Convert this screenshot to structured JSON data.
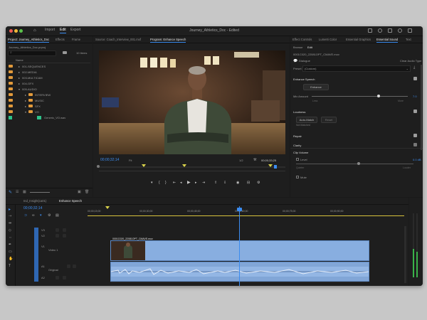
{
  "window": {
    "title": "Journey_Athletics_Doc - Edited"
  },
  "nav": {
    "import": "Import",
    "edit": "Edit",
    "export": "Export"
  },
  "project": {
    "tabs": [
      "Project: Journey_Athletics_Doc",
      "Effects",
      "Frame"
    ],
    "file": "Journey_Athletics_Doc.prproj",
    "item_count": "10 Items",
    "header": "Name",
    "folders": [
      "001-SEQUENCES",
      "002-MEDIA",
      "003-MULTICAM",
      "004-GFX",
      "005-AUDIO",
      "INTERVIEW",
      "MUSIC",
      "SFX",
      "VO"
    ],
    "file_item": "Generic_VO.wav"
  },
  "program": {
    "tabs": [
      "Source: Coach_Interview_001.mxf",
      "Program: Enhance Speech"
    ],
    "timecode": "00;00;32;14",
    "duration": "00;00;33;25",
    "fit": "Fit",
    "quality": "1/2"
  },
  "essential_sound": {
    "tabs": [
      "Effect Controls",
      "Lumetri Color",
      "Essential Graphics",
      "Essential Sound",
      "Text"
    ],
    "subtabs": [
      "Browse",
      "Edit"
    ],
    "clip_name": "0001C020_22081OPT_CMAVE.mov",
    "dialogue_label": "Dialogue",
    "clear_type": "Clear Audio Type",
    "preset_label": "Preset",
    "preset_value": "(Custom)",
    "enhance_speech": "Enhance Speech",
    "enhance_button": "Enhance",
    "mix_amount": "Mix Amount",
    "mix_value": "7.0",
    "less": "Less",
    "more": "More",
    "loudness": "Loudness",
    "auto_match": "Auto-Match",
    "reset": "Reset",
    "not_matched": "Not Matched",
    "repair": "Repair",
    "clarity": "Clarity",
    "clip_volume": "Clip Volume",
    "level": "Level",
    "level_value": "0.0 dB",
    "quieter": "Quieter",
    "louder": "Louder",
    "mute": "Mute"
  },
  "timeline": {
    "tabs": [
      "Ind_Insight(ca01)",
      "Enhance Speech"
    ],
    "timecode": "00;00;32;14",
    "ruler": [
      "00;00;15;00",
      "00;00;30;00",
      "00;00;45;00",
      "00;00;60;00",
      "00;00;75;00",
      "00;00;90;00"
    ],
    "video_clip": "0001C020_22081OPT_CMAVE.mov",
    "tracks": [
      "V3",
      "V2",
      "V1",
      "A1",
      "A2",
      "A3",
      "A4"
    ],
    "video_label": "Video 1",
    "audio_label": "Original"
  }
}
